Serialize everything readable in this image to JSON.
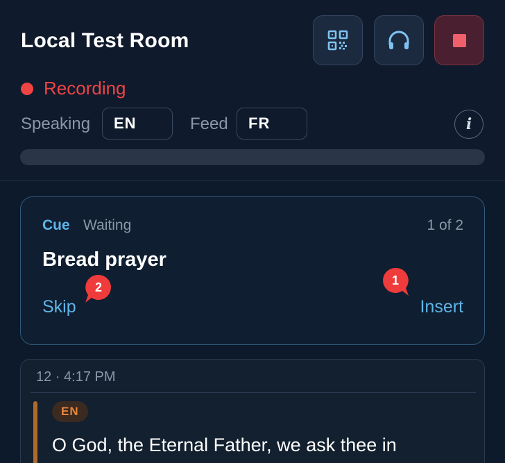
{
  "header": {
    "title": "Local Test Room",
    "buttons": {
      "qr": {
        "icon": "qr-code-icon"
      },
      "headphones": {
        "icon": "headphones-icon"
      },
      "stop": {
        "icon": "stop-icon"
      }
    },
    "recording": {
      "label": "Recording",
      "color": "#ef4444"
    },
    "speaking": {
      "label": "Speaking",
      "value": "EN"
    },
    "feed": {
      "label": "Feed",
      "value": "FR"
    },
    "info": {
      "label": "i",
      "icon": "info-icon"
    },
    "progress": {
      "fraction": 0
    }
  },
  "cue": {
    "tag": "Cue",
    "status": "Waiting",
    "count": "1 of 2",
    "title": "Bread prayer",
    "skip_label": "Skip",
    "insert_label": "Insert",
    "badge_skip": "2",
    "badge_insert": "1"
  },
  "message": {
    "meta": "12 · 4:17 PM",
    "lang": "EN",
    "text": "O God, the Eternal Father, we ask thee in"
  },
  "colors": {
    "accent": "#5fb4e8",
    "record": "#ef4444",
    "lang_tag": "#e8863a"
  }
}
